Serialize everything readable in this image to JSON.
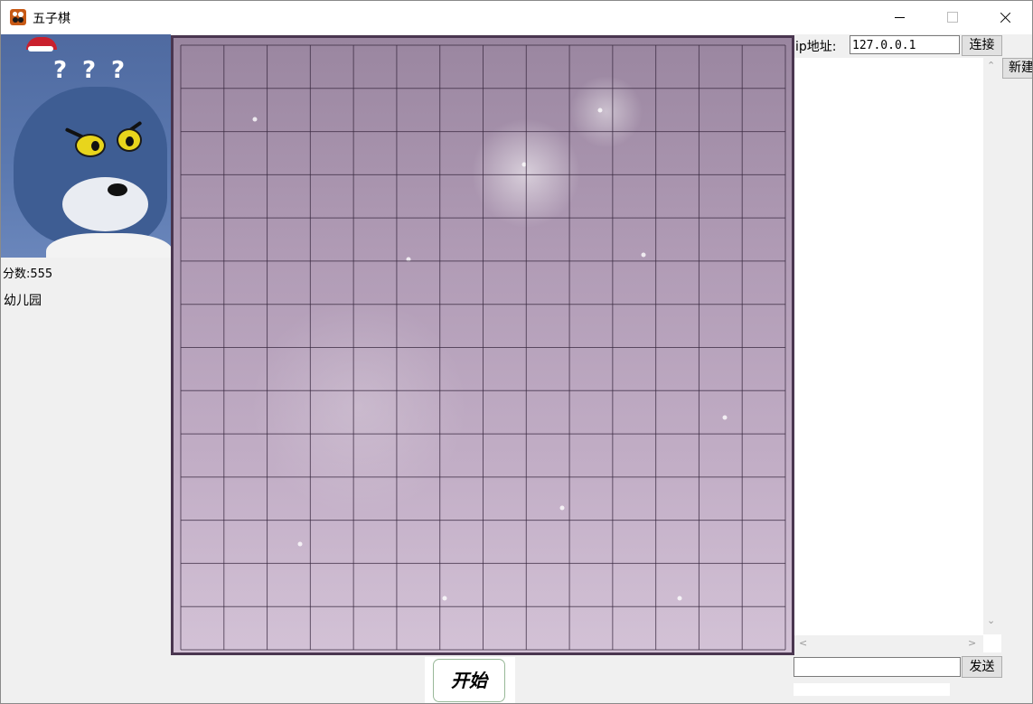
{
  "window": {
    "title": "五子棋",
    "minimize_icon": "minimize-icon",
    "maximize_icon": "maximize-icon",
    "close_icon": "close-icon"
  },
  "player": {
    "avatar_question_marks": [
      "?",
      "?",
      "?"
    ],
    "score_text": "分数:555",
    "rank_text": "幼儿园"
  },
  "board": {
    "lines": 15,
    "line_color": "#3a2a40",
    "frame_color": "#4a3650"
  },
  "start_button": {
    "label": "开始"
  },
  "network": {
    "ip_label": "ip地址:",
    "ip_value": "127.0.0.1",
    "connect_label": "连接",
    "new_label": "新建"
  },
  "chat": {
    "messages": [],
    "input_value": "",
    "send_label": "发送"
  }
}
